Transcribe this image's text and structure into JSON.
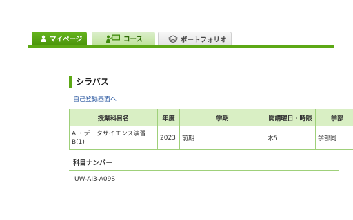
{
  "nav": {
    "tabs": [
      {
        "label": "マイページ",
        "icon": "person-icon",
        "active": true
      },
      {
        "label": "コース",
        "icon": "teacher-board-icon",
        "active": false
      },
      {
        "label": "ポートフォリオ",
        "icon": "stack-icon",
        "active": false
      }
    ]
  },
  "colors": {
    "accent_green": "#5ca815",
    "header_fill": "#d9efc4",
    "border_green": "#9fd07a",
    "link_blue": "#1f4f9b"
  },
  "syllabus": {
    "title": "シラバス",
    "self_register_link": "自己登録画面へ",
    "table": {
      "headers": [
        "授業科目名",
        "年度",
        "学期",
        "開講曜日・時限",
        "学部"
      ],
      "rows": [
        [
          "AI・データサイエンス演習B(1)",
          "2023",
          "前期",
          "木5",
          "学部同"
        ]
      ]
    },
    "course_number_heading": "科目ナンバー",
    "course_number": "UW-AI3-A09S"
  }
}
